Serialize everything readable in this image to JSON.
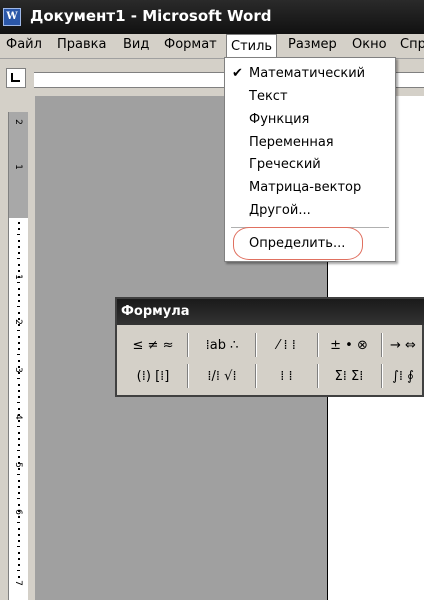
{
  "window": {
    "title": "Документ1 - Microsoft Word",
    "app_icon_letter": "W"
  },
  "menubar": {
    "items": [
      "Файл",
      "Правка",
      "Вид",
      "Формат",
      "Стиль",
      "Размер",
      "Окно",
      "Спр"
    ],
    "active": "Стиль"
  },
  "ruler": {
    "numbers": [
      "2",
      "1",
      "1",
      "2",
      "3",
      "4",
      "5",
      "6",
      "7"
    ]
  },
  "style_menu": {
    "items": [
      {
        "label": "Математический",
        "checked": true
      },
      {
        "label": "Текст",
        "checked": false
      },
      {
        "label": "Функция",
        "checked": false
      },
      {
        "label": "Переменная",
        "checked": false
      },
      {
        "label": "Греческий",
        "checked": false
      },
      {
        "label": "Матрица-вектор",
        "checked": false
      },
      {
        "label": "Другой...",
        "checked": false
      }
    ],
    "define_label": "Определить...",
    "check_mark": "✔"
  },
  "formula_toolbar": {
    "title": "Формула",
    "row1": [
      "≤ ≠ ≈",
      "⁞ab ∴",
      "⁄ ⁞ ⁞",
      "± • ⊗",
      "→ ⇔"
    ],
    "row2": [
      "(⁞) [⁞]",
      "⁞/⁞ √⁞",
      "⁞ ⁞",
      "Σ⁞ Σ⁞",
      "∫⁞ ∮"
    ]
  }
}
